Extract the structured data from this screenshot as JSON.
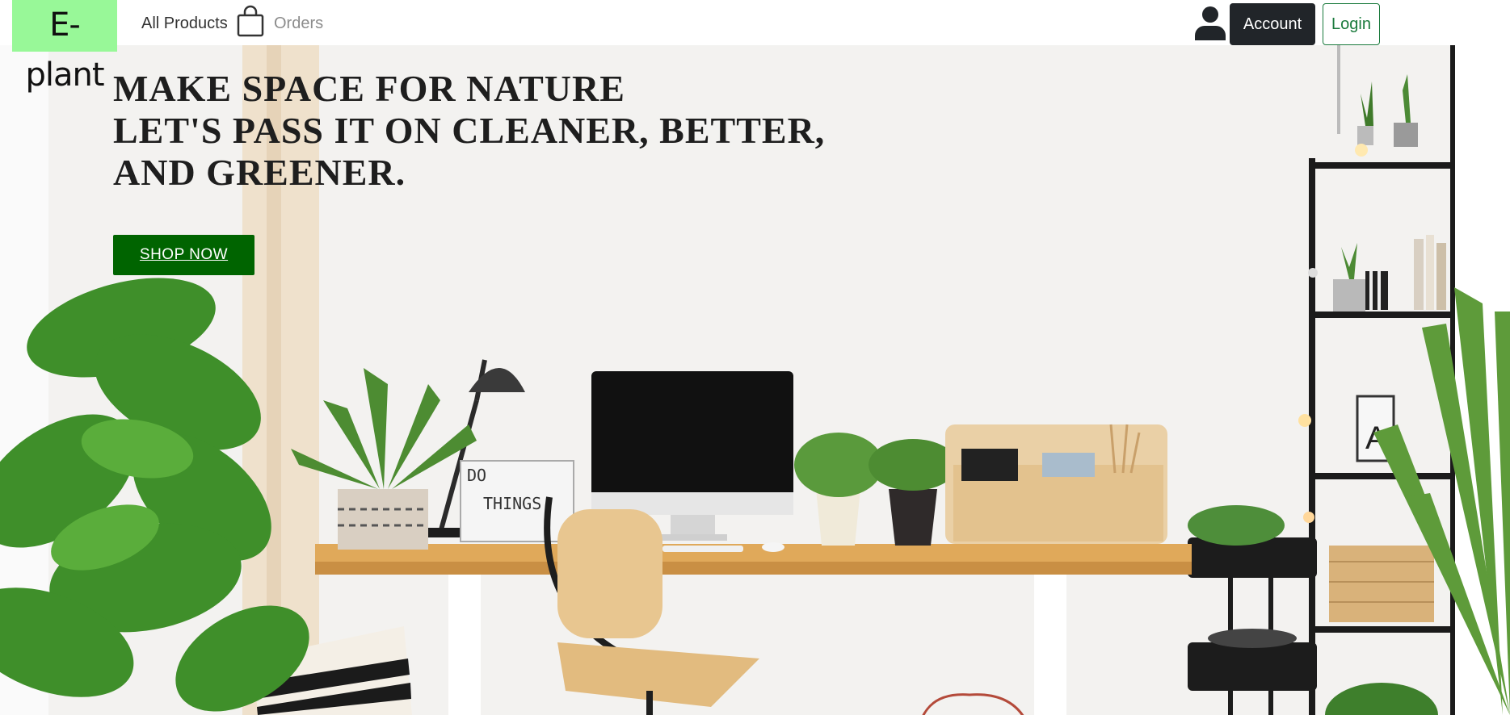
{
  "navbar": {
    "brand": "E-plant",
    "all_products": "All Products",
    "orders": "Orders",
    "account": "Account",
    "login": "Login",
    "icons": {
      "bag": "shopping-bag-icon",
      "user": "user-icon"
    }
  },
  "hero": {
    "headline_line1": "MAKE SPACE FOR NATURE",
    "headline_line2": "LET'S PASS IT ON CLEANER, BETTER, AND GREENER.",
    "cta": "SHOP NOW",
    "lightbox_text_1": "DO",
    "lightbox_text_2": "THINGS"
  },
  "colors": {
    "brand_bg": "#98f898",
    "cta_green": "#006400",
    "account_dark": "#212529",
    "login_green": "#1a7a3c"
  }
}
